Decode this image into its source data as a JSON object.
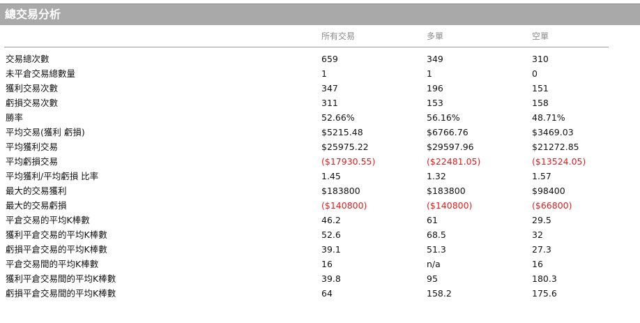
{
  "header": {
    "title": "總交易分析"
  },
  "columns": {
    "all": "所有交易",
    "long": "多單",
    "short": "空單"
  },
  "rows": [
    {
      "label": "交易總次數",
      "all": "659",
      "long": "349",
      "short": "310"
    },
    {
      "label": "未平倉交易總數量",
      "all": "1",
      "long": "1",
      "short": "0"
    },
    {
      "label": "獲利交易次數",
      "all": "347",
      "long": "196",
      "short": "151"
    },
    {
      "label": "虧損交易次數",
      "all": "311",
      "long": "153",
      "short": "158"
    },
    {
      "label": "勝率",
      "all": "52.66%",
      "long": "56.16%",
      "short": "48.71%"
    },
    {
      "label": "平均交易(獲利 虧損)",
      "all": "$5215.48",
      "long": "$6766.76",
      "short": "$3469.03"
    },
    {
      "label": "平均獲利交易",
      "all": "$25975.22",
      "long": "$29597.96",
      "short": "$21272.85"
    },
    {
      "label": "平均虧損交易",
      "all": "($17930.55)",
      "long": "($22481.05)",
      "short": "($13524.05)",
      "negative": true
    },
    {
      "label": "平均獲利/平均虧損 比率",
      "all": "1.45",
      "long": "1.32",
      "short": "1.57"
    },
    {
      "label": "最大的交易獲利",
      "all": "$183800",
      "long": "$183800",
      "short": "$98400"
    },
    {
      "label": "最大的交易虧損",
      "all": "($140800)",
      "long": "($140800)",
      "short": "($66800)",
      "negative": true
    },
    {
      "label": "平倉交易的平均K棒數",
      "all": "46.2",
      "long": "61",
      "short": "29.5"
    },
    {
      "label": "獲利平倉交易的平均K棒數",
      "all": "52.6",
      "long": "68.5",
      "short": "32"
    },
    {
      "label": "虧損平倉交易的平均K棒數",
      "all": "39.1",
      "long": "51.3",
      "short": "27.3"
    },
    {
      "label": "平倉交易間的平均K棒數",
      "all": "16",
      "long": "n/a",
      "short": "16"
    },
    {
      "label": "獲利平倉交易間的平均K棒數",
      "all": "39.8",
      "long": "95",
      "short": "180.3"
    },
    {
      "label": "虧損平倉交易間的平均K棒數",
      "all": "64",
      "long": "158.2",
      "short": "175.6"
    }
  ],
  "colors": {
    "header_bg": "#a9a9a9",
    "negative": "#e31b1b"
  }
}
